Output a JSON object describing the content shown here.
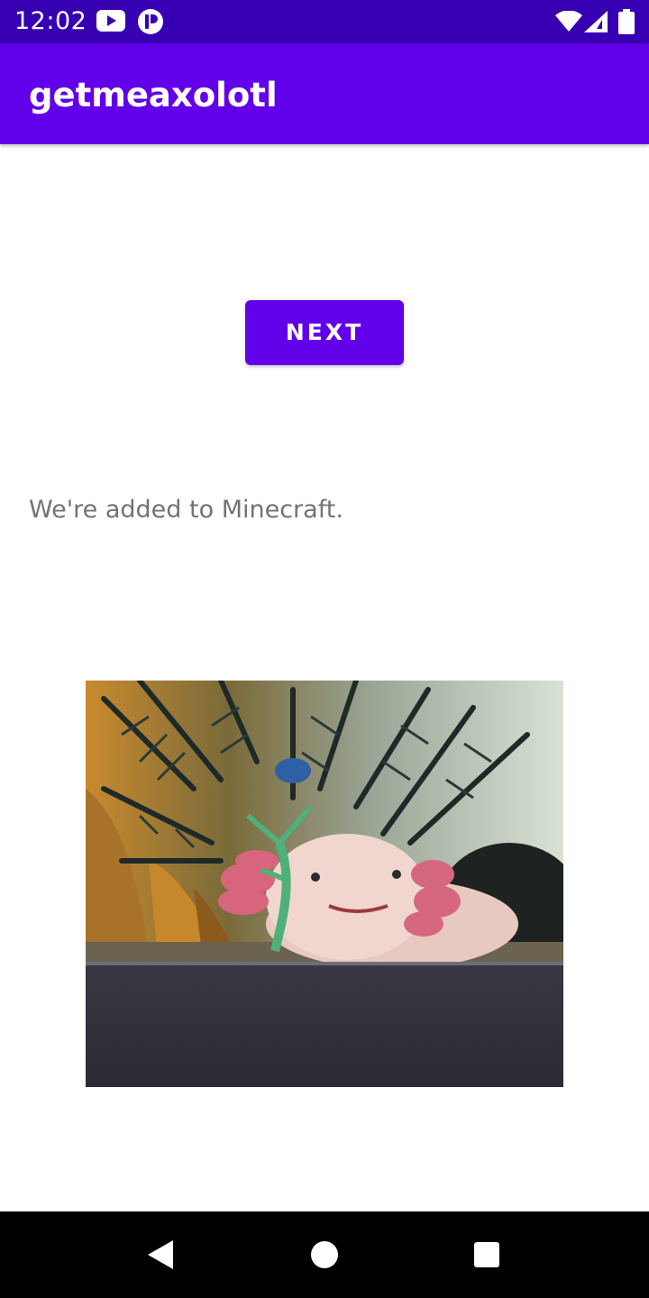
{
  "status_bar": {
    "time": "12:02",
    "icons_left": [
      "youtube-icon",
      "podcast-app-icon"
    ],
    "icons_right": [
      "wifi-icon",
      "cell-signal-icon",
      "battery-icon"
    ]
  },
  "app_bar": {
    "title": "getmeaxolotl"
  },
  "main": {
    "next_label": "NEXT",
    "fact_text": "We're added to Minecraft.",
    "photo_subject": "axolotl-photo"
  },
  "nav_bar": {
    "buttons": [
      "back-button",
      "home-button",
      "recents-button"
    ]
  },
  "colors": {
    "status_bar": "#3700b3",
    "app_bar": "#6200ea",
    "button": "#6200ea",
    "fact_text": "#737373",
    "nav_bar": "#000000"
  }
}
